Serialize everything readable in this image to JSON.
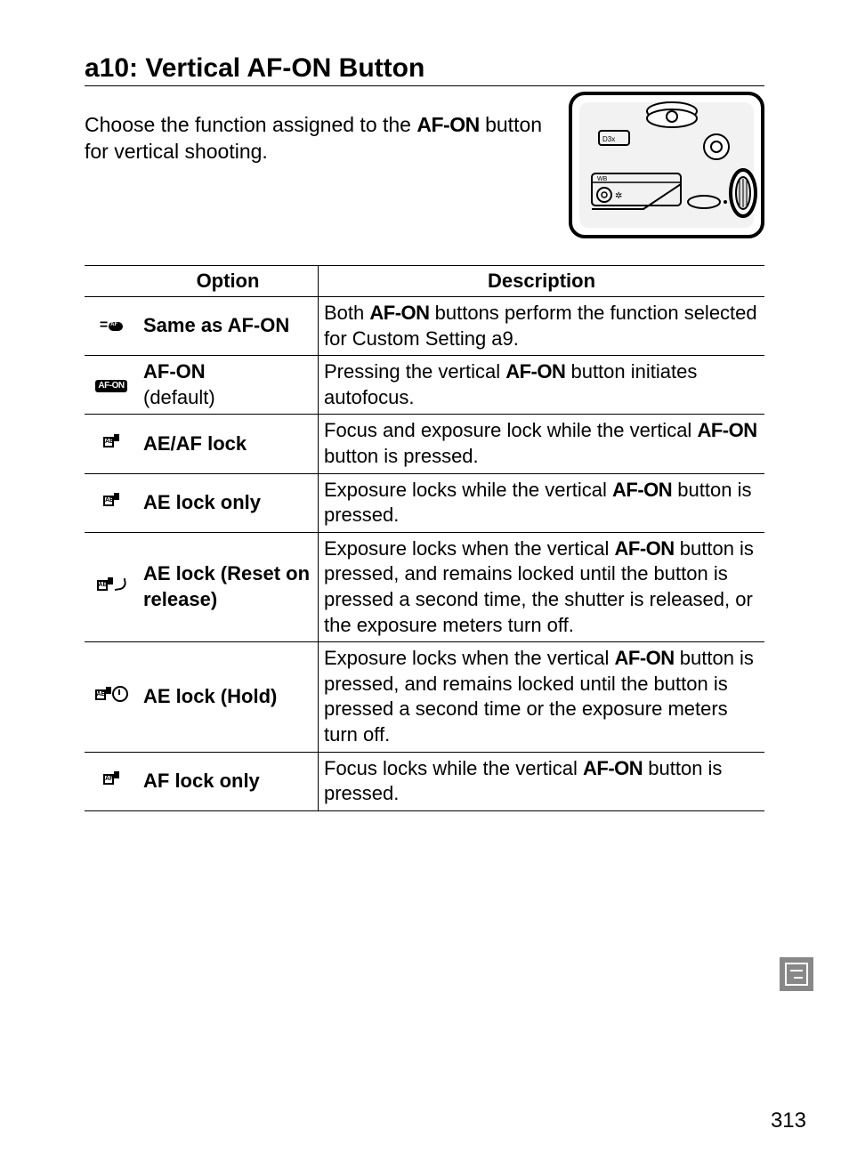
{
  "title": "a10: Vertical AF-ON Button",
  "intro_before": "Choose the function assigned to the ",
  "intro_afon": "AF-ON",
  "intro_after": " button for vertical shooting.",
  "table": {
    "headers": {
      "option": "Option",
      "description": "Description"
    },
    "rows": [
      {
        "icon": "same-as-afon-icon",
        "option": "Same as AF-ON",
        "default": "",
        "desc_before": "Both ",
        "desc_afon": "AF-ON",
        "desc_after": " buttons perform the function selected for Custom Setting a9."
      },
      {
        "icon": "afon-badge-icon",
        "option": "AF-ON",
        "default": "(default)",
        "desc_before": "Pressing the vertical ",
        "desc_afon": "AF-ON",
        "desc_after": " button initiates autofocus."
      },
      {
        "icon": "ae-af-lock-icon",
        "option": "AE/AF lock",
        "default": "",
        "desc_before": "Focus and exposure lock while the vertical ",
        "desc_afon": "AF-ON",
        "desc_after": " button is pressed."
      },
      {
        "icon": "ae-lock-only-icon",
        "option": "AE lock only",
        "default": "",
        "desc_before": "Exposure locks while the vertical ",
        "desc_afon": "AF-ON",
        "desc_after": " button is pressed."
      },
      {
        "icon": "ae-lock-reset-icon",
        "option": "AE lock (Reset on release)",
        "default": "",
        "desc_before": "Exposure locks when the vertical ",
        "desc_afon": "AF-ON",
        "desc_after": " button is pressed, and remains locked until the button is pressed a second time, the shutter is released, or the exposure meters turn off."
      },
      {
        "icon": "ae-lock-hold-icon",
        "option": "AE lock (Hold)",
        "default": "",
        "desc_before": "Exposure locks when the vertical ",
        "desc_afon": "AF-ON",
        "desc_after": " button is pressed, and remains locked until the button is pressed a second time or the exposure meters turn off."
      },
      {
        "icon": "af-lock-only-icon",
        "option": "AF lock only",
        "default": "",
        "desc_before": "Focus locks while the vertical ",
        "desc_afon": "AF-ON",
        "desc_after": " button is pressed."
      }
    ]
  },
  "page_number": "313"
}
